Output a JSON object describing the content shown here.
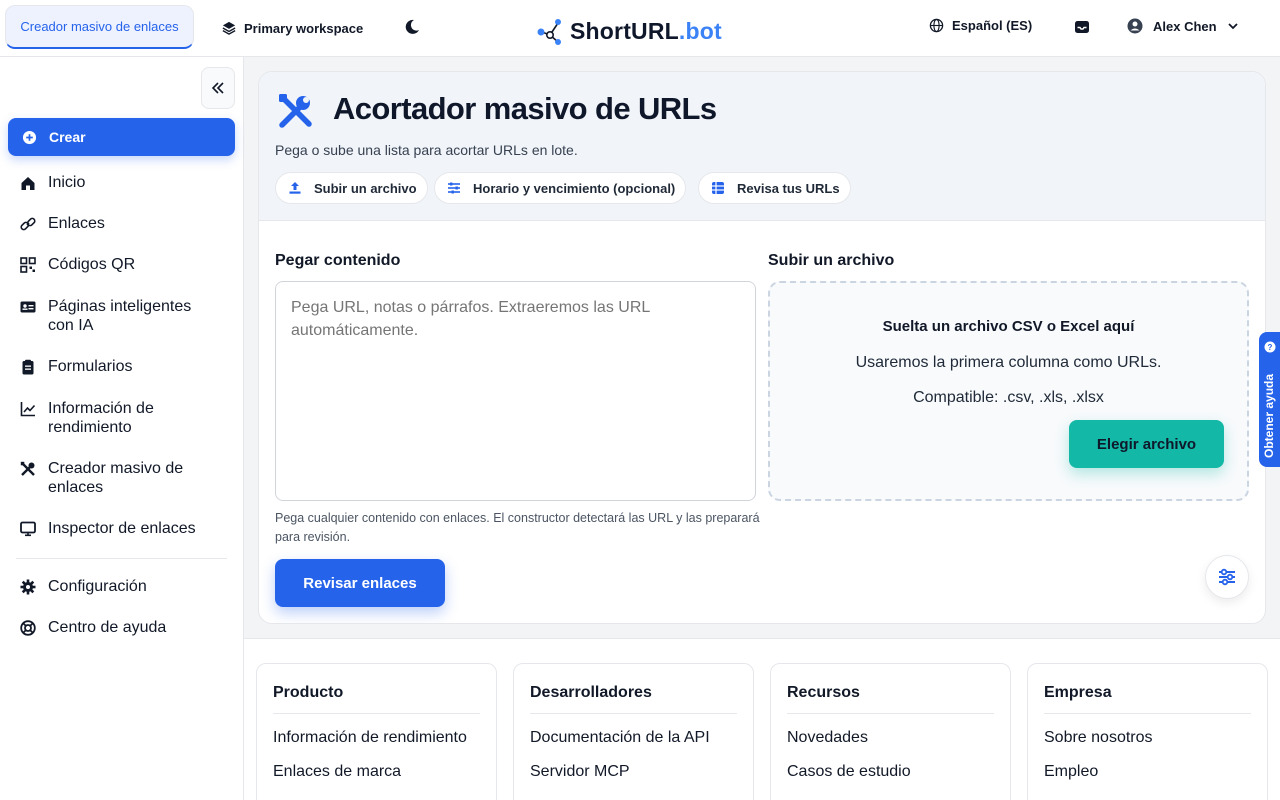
{
  "topbar": {
    "active_tab": "Creador masivo de enlaces",
    "workspace": "Primary workspace",
    "logo_main": "ShortURL",
    "logo_dot": ".bot",
    "language": "Español (ES)",
    "user_name": "Alex Chen"
  },
  "sidebar": {
    "create": "Crear",
    "items": [
      {
        "label": "Inicio",
        "icon": "home-icon"
      },
      {
        "label": "Enlaces",
        "icon": "link-icon"
      },
      {
        "label": "Códigos QR",
        "icon": "qr-code-icon"
      },
      {
        "label": "Páginas inteligentes con IA",
        "icon": "id-card-icon"
      },
      {
        "label": "Formularios",
        "icon": "clipboard-icon"
      },
      {
        "label": "Información de rendimiento",
        "icon": "chart-line-icon"
      },
      {
        "label": "Creador masivo de enlaces",
        "icon": "tools-icon"
      },
      {
        "label": "Inspector de enlaces",
        "icon": "monitor-icon"
      }
    ],
    "bottom_items": [
      {
        "label": "Configuración",
        "icon": "gear-icon"
      },
      {
        "label": "Centro de ayuda",
        "icon": "lifebuoy-icon"
      }
    ]
  },
  "main": {
    "title": "Acortador masivo de URLs",
    "subtitle": "Pega o sube una lista para acortar URLs en lote.",
    "pills": [
      {
        "label": "Subir un archivo",
        "icon": "upload-icon"
      },
      {
        "label": "Horario y vencimiento (opcional)",
        "icon": "sliders-icon"
      },
      {
        "label": "Revisa tus URLs",
        "icon": "grid-icon"
      }
    ],
    "paste_label": "Pegar contenido",
    "paste_placeholder": "Pega URL, notas o párrafos. Extraeremos las URL automáticamente.",
    "paste_help": "Pega cualquier contenido con enlaces. El constructor detectará las URL y las preparará para revisión.",
    "review_button": "Revisar enlaces",
    "upload_label": "Subir un archivo",
    "drop_title": "Suelta un archivo CSV o Excel aquí",
    "drop_line1": "Usaremos la primera columna como URLs.",
    "drop_line2": "Compatible: .csv, .xls, .xlsx",
    "choose_button": "Elegir archivo"
  },
  "help_tab": "Obtener ayuda",
  "footer": {
    "columns": [
      {
        "title": "Producto",
        "links": [
          "Información de rendimiento",
          "Enlaces de marca"
        ]
      },
      {
        "title": "Desarrolladores",
        "links": [
          "Documentación de la API",
          "Servidor MCP"
        ]
      },
      {
        "title": "Recursos",
        "links": [
          "Novedades",
          "Casos de estudio"
        ]
      },
      {
        "title": "Empresa",
        "links": [
          "Sobre nosotros",
          "Empleo"
        ]
      }
    ]
  },
  "colors": {
    "primary": "#2563eb",
    "accent_teal": "#14b8a6",
    "logo_dot": "#3b82f6"
  }
}
